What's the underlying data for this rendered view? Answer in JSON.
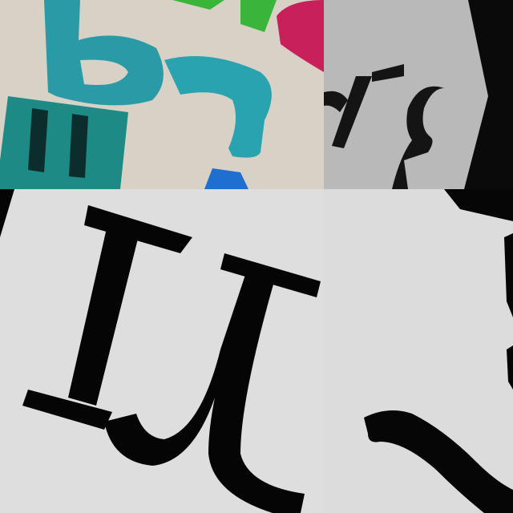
{
  "tiles": [
    {
      "id": "tile-tl",
      "subject": "magnetic-letters",
      "colors": {
        "teal": "#2a9aa6",
        "dark_teal": "#1d7a78",
        "magenta": "#c8205a",
        "green": "#3bb43a",
        "blue": "#1f6fd0",
        "wall": "#d8d2c6"
      }
    },
    {
      "id": "tile-tr",
      "subject": "rotated-print",
      "colors": {
        "paper": "#b9b9b9",
        "ink": "#141414",
        "dark_edge": "#0a0a0a"
      }
    },
    {
      "id": "tile-bl",
      "subject": "serif-glyph",
      "colors": {
        "paper": "#dedede",
        "ink": "#050505"
      }
    },
    {
      "id": "tile-br",
      "subject": "glyph-stroke",
      "colors": {
        "paper": "#dcdcdc",
        "ink": "#060606"
      }
    }
  ]
}
